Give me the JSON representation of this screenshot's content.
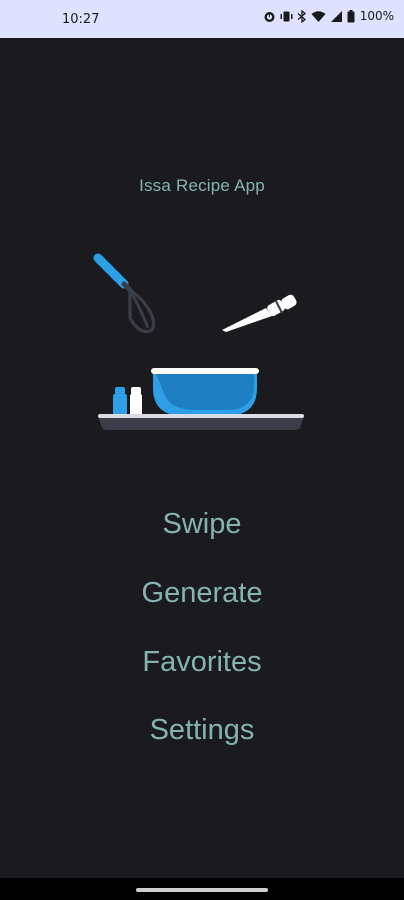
{
  "status_bar": {
    "time": "10:27",
    "icons": [
      "alarm-icon",
      "vibrate-icon",
      "bluetooth-icon",
      "wifi-icon",
      "signal-icon",
      "battery-icon"
    ],
    "battery": "100%"
  },
  "app": {
    "title": "Issa Recipe App"
  },
  "menu": {
    "items": [
      {
        "label": "Swipe"
      },
      {
        "label": "Generate"
      },
      {
        "label": "Favorites"
      },
      {
        "label": "Settings"
      }
    ]
  },
  "colors": {
    "background": "#1b1b1f",
    "status_bar": "#dfe2ff",
    "text_accent": "#84b4b1",
    "bowl_blue": "#2e9ee6",
    "tray": "#3a3e48"
  }
}
